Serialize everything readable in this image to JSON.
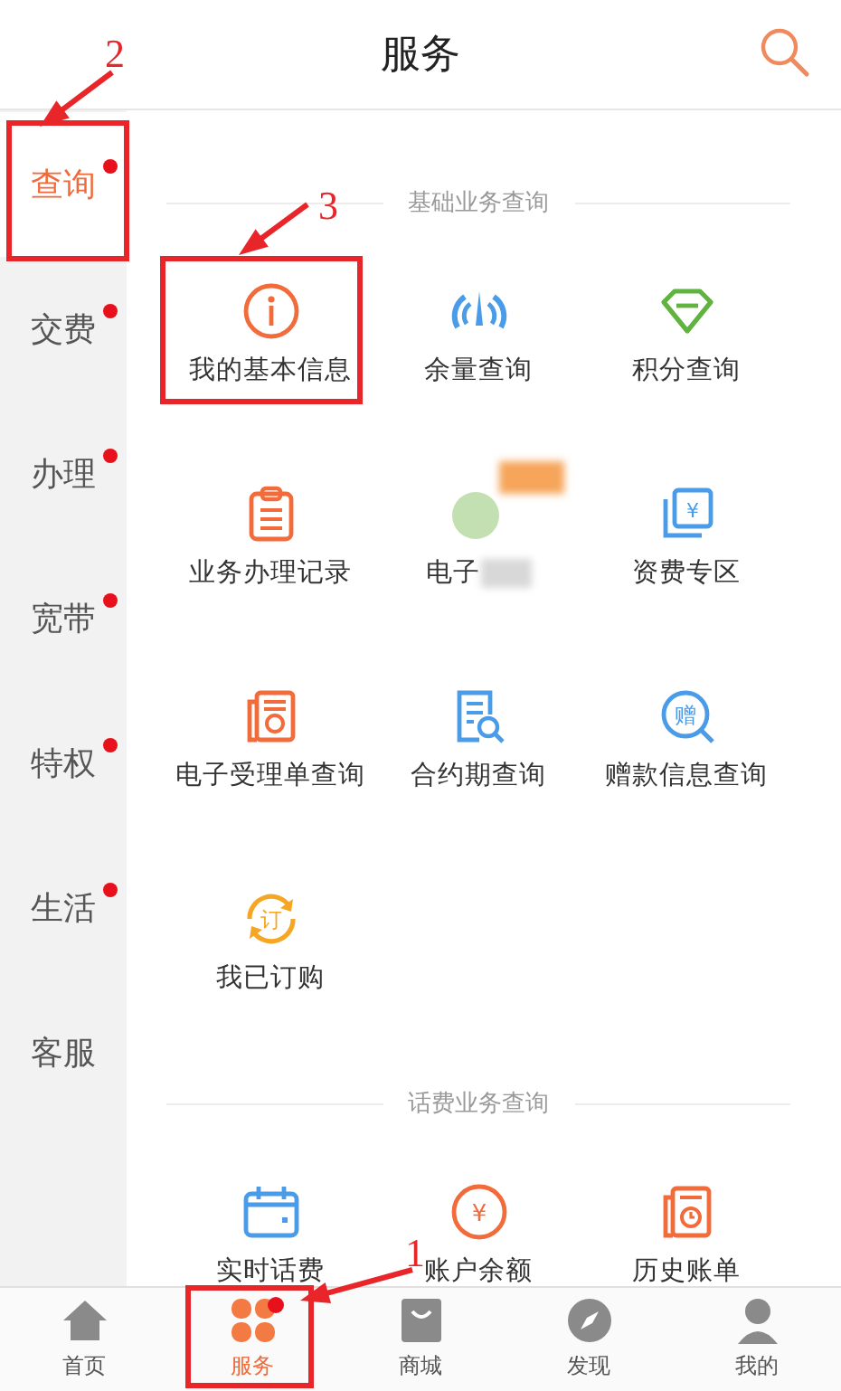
{
  "header": {
    "title": "服务"
  },
  "sidebar": {
    "items": [
      {
        "label": "查询",
        "selected": true,
        "dot": true
      },
      {
        "label": "交费",
        "selected": false,
        "dot": true
      },
      {
        "label": "办理",
        "selected": false,
        "dot": true
      },
      {
        "label": "宽带",
        "selected": false,
        "dot": true
      },
      {
        "label": "特权",
        "selected": false,
        "dot": true
      },
      {
        "label": "生活",
        "selected": false,
        "dot": true
      },
      {
        "label": "客服",
        "selected": false,
        "dot": false
      }
    ]
  },
  "sections": [
    {
      "title": "基础业务查询",
      "items": [
        {
          "label": "我的基本信息",
          "kind": "info"
        },
        {
          "label": "余量查询",
          "kind": "gauge"
        },
        {
          "label": "积分查询",
          "kind": "diamond"
        },
        {
          "label": "业务办理记录",
          "kind": "clipboard"
        },
        {
          "label": "电子",
          "kind": "blurred"
        },
        {
          "label": "资费专区",
          "kind": "cards",
          "glyph": "¥"
        },
        {
          "label": "电子受理单查询",
          "kind": "receipt"
        },
        {
          "label": "合约期查询",
          "kind": "docsearch"
        },
        {
          "label": "赠款信息查询",
          "kind": "circlesearch",
          "glyph": "赠"
        },
        {
          "label": "我已订购",
          "kind": "cycle",
          "glyph": "订"
        }
      ]
    },
    {
      "title": "话费业务查询",
      "items": [
        {
          "label": "实时话费",
          "kind": "calendar"
        },
        {
          "label": "账户余额",
          "kind": "coin",
          "glyph": "¥"
        },
        {
          "label": "历史账单",
          "kind": "billclock"
        }
      ]
    }
  ],
  "tab_bar": [
    {
      "label": "首页",
      "kind": "home",
      "selected": false,
      "dot": false
    },
    {
      "label": "服务",
      "kind": "clover",
      "selected": true,
      "dot": true
    },
    {
      "label": "商城",
      "kind": "bag",
      "selected": false,
      "dot": false
    },
    {
      "label": "发现",
      "kind": "compass",
      "selected": false,
      "dot": false
    },
    {
      "label": "我的",
      "kind": "person",
      "selected": false,
      "dot": false
    }
  ],
  "annotations": [
    {
      "number": "2"
    },
    {
      "number": "3"
    },
    {
      "number": "1"
    }
  ]
}
